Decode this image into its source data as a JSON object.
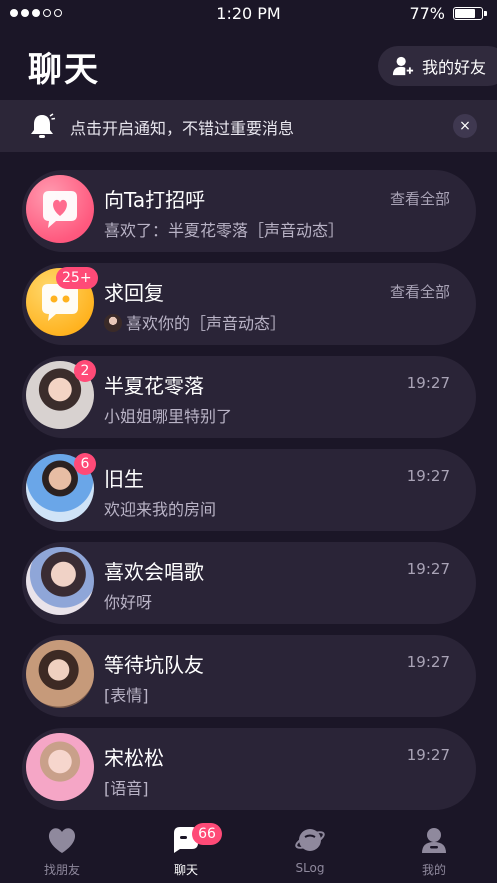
{
  "status_bar": {
    "time": "1:20 PM",
    "battery": "77%",
    "battery_level": 0.77
  },
  "header": {
    "title": "聊天",
    "friends_button": "我的好友"
  },
  "notification": {
    "text": "点击开启通知，不错过重要消息",
    "close": "×"
  },
  "chats": [
    {
      "name": "向Ta打招呼",
      "preview": "喜欢了：半夏花零落［声音动态］",
      "time": "查看全部",
      "badge": "",
      "avatar_icon": "heart-chat-icon"
    },
    {
      "name": "求回复",
      "preview": "喜欢你的［声音动态］",
      "time": "查看全部",
      "badge": "25+",
      "avatar_icon": "chat-bubble-icon"
    },
    {
      "name": "半夏花零落",
      "preview": "小姐姐哪里特别了",
      "time": "19:27",
      "badge": "2",
      "avatar_icon": "user-photo"
    },
    {
      "name": "旧生",
      "preview": "欢迎来我的房间",
      "time": "19:27",
      "badge": "6",
      "avatar_icon": "user-photo"
    },
    {
      "name": "喜欢会唱歌",
      "preview": "你好呀",
      "time": "19:27",
      "badge": "",
      "avatar_icon": "user-photo"
    },
    {
      "name": "等待坑队友",
      "preview": "[表情]",
      "time": "19:27",
      "badge": "",
      "avatar_icon": "user-photo"
    },
    {
      "name": "宋松松",
      "preview": "[语音]",
      "time": "19:27",
      "badge": "",
      "avatar_icon": "user-photo"
    }
  ],
  "tabs": [
    {
      "label": "找朋友",
      "icon": "heart-icon",
      "active": false
    },
    {
      "label": "聊天",
      "icon": "chat-icon",
      "active": true,
      "badge": "66"
    },
    {
      "label": "SLog",
      "icon": "planet-icon",
      "active": false
    },
    {
      "label": "我的",
      "icon": "profile-icon",
      "active": false
    }
  ],
  "colors": {
    "background": "#1b1627",
    "card": "#2a2437",
    "accent": "#ff4a77"
  }
}
